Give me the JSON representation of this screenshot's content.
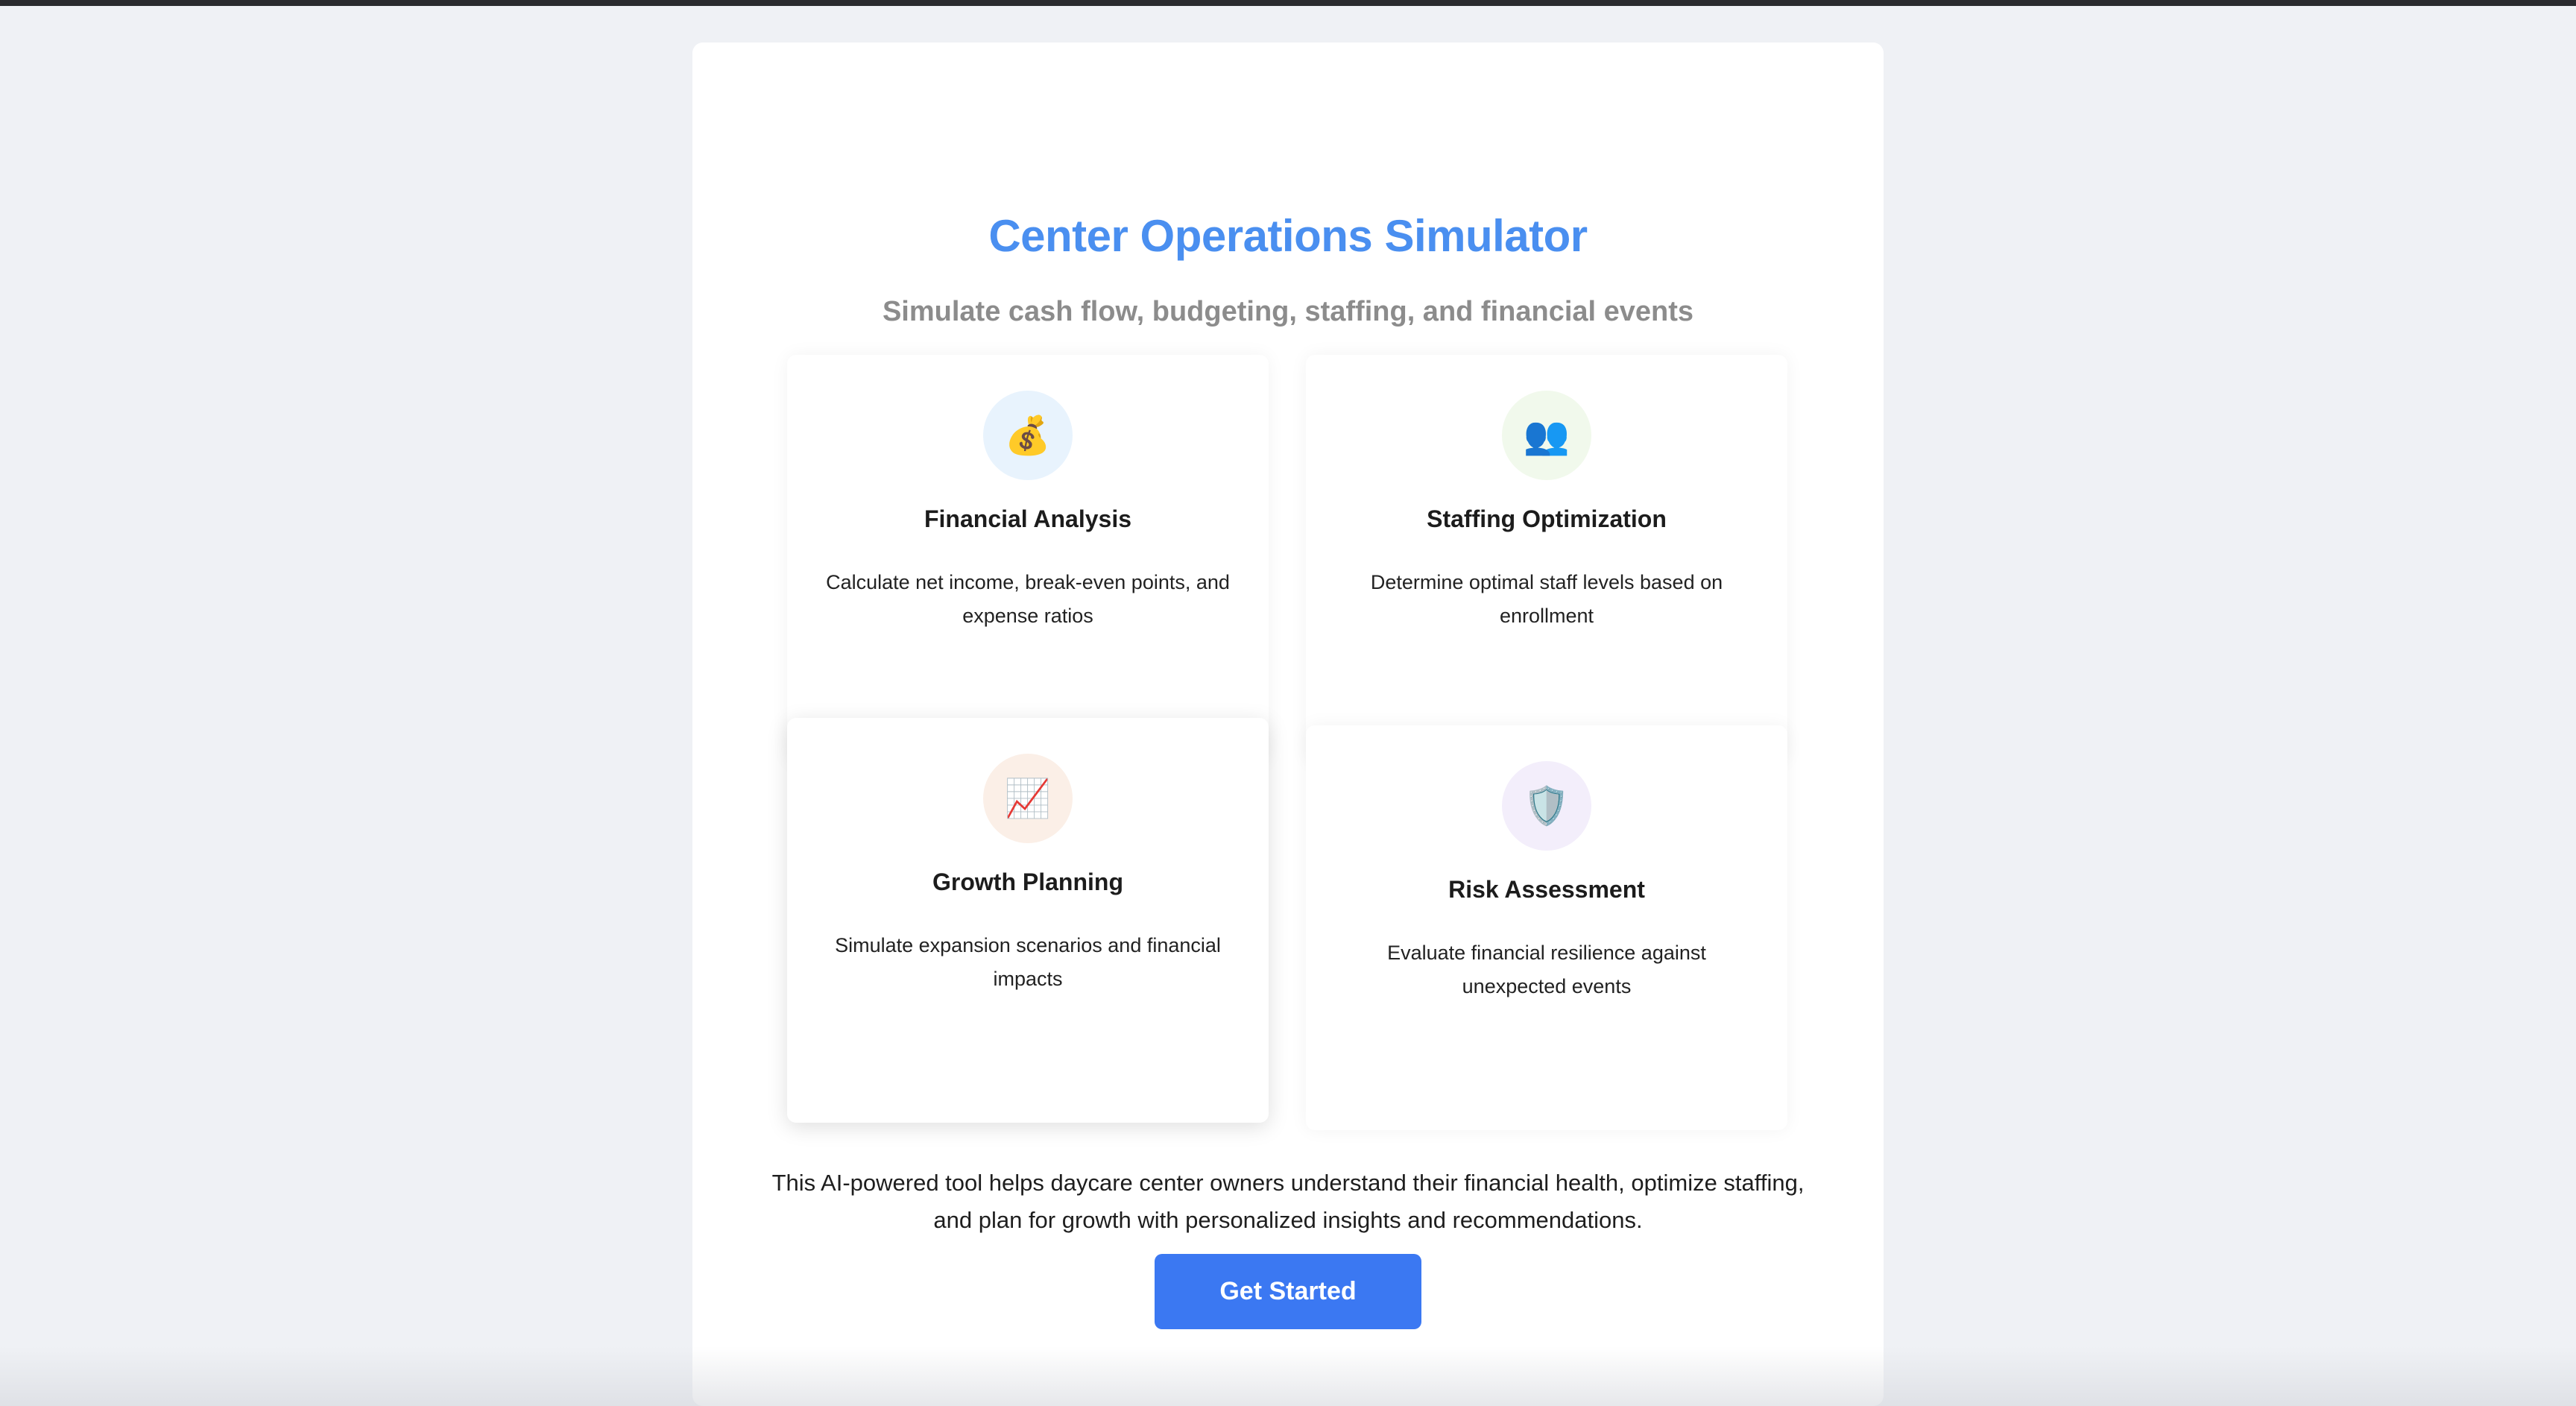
{
  "app": {
    "title": "Center Operations Simulator",
    "subtitle": "Simulate cash flow, budgeting, staffing, and financial events"
  },
  "features": [
    {
      "icon": "money-bag-icon",
      "glyph": "💰",
      "icon_bg": "#e8f3fd",
      "title": "Financial Analysis",
      "description": "Calculate net income, break-even points, and expense ratios"
    },
    {
      "icon": "people-icon",
      "glyph": "👥",
      "icon_bg": "#f1f9ec",
      "title": "Staffing Optimization",
      "description": "Determine optimal staff levels based on enrollment"
    },
    {
      "icon": "chart-increasing-icon",
      "glyph": "📈",
      "icon_bg": "#fbefe7",
      "title": "Growth Planning",
      "description": "Simulate expansion scenarios and financial impacts"
    },
    {
      "icon": "shield-icon",
      "glyph": "🛡️",
      "icon_bg": "#f3eefb",
      "title": "Risk Assessment",
      "description": "Evaluate financial resilience against unexpected events"
    }
  ],
  "description": "This AI-powered tool helps daycare center owners understand their financial health, optimize staffing, and plan for growth with personalized insights and recommendations.",
  "cta": {
    "label": "Get Started"
  },
  "colors": {
    "accent": "#4a8ff0",
    "button": "#3b78f2",
    "background": "#eff1f5"
  }
}
